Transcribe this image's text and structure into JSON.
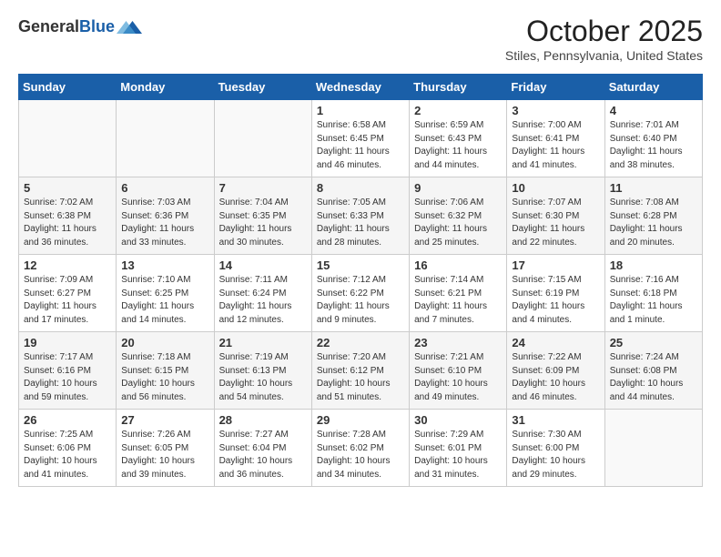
{
  "header": {
    "logo_general": "General",
    "logo_blue": "Blue",
    "month_title": "October 2025",
    "location": "Stiles, Pennsylvania, United States"
  },
  "days_of_week": [
    "Sunday",
    "Monday",
    "Tuesday",
    "Wednesday",
    "Thursday",
    "Friday",
    "Saturday"
  ],
  "weeks": [
    [
      {
        "day": "",
        "info": ""
      },
      {
        "day": "",
        "info": ""
      },
      {
        "day": "",
        "info": ""
      },
      {
        "day": "1",
        "info": "Sunrise: 6:58 AM\nSunset: 6:45 PM\nDaylight: 11 hours\nand 46 minutes."
      },
      {
        "day": "2",
        "info": "Sunrise: 6:59 AM\nSunset: 6:43 PM\nDaylight: 11 hours\nand 44 minutes."
      },
      {
        "day": "3",
        "info": "Sunrise: 7:00 AM\nSunset: 6:41 PM\nDaylight: 11 hours\nand 41 minutes."
      },
      {
        "day": "4",
        "info": "Sunrise: 7:01 AM\nSunset: 6:40 PM\nDaylight: 11 hours\nand 38 minutes."
      }
    ],
    [
      {
        "day": "5",
        "info": "Sunrise: 7:02 AM\nSunset: 6:38 PM\nDaylight: 11 hours\nand 36 minutes."
      },
      {
        "day": "6",
        "info": "Sunrise: 7:03 AM\nSunset: 6:36 PM\nDaylight: 11 hours\nand 33 minutes."
      },
      {
        "day": "7",
        "info": "Sunrise: 7:04 AM\nSunset: 6:35 PM\nDaylight: 11 hours\nand 30 minutes."
      },
      {
        "day": "8",
        "info": "Sunrise: 7:05 AM\nSunset: 6:33 PM\nDaylight: 11 hours\nand 28 minutes."
      },
      {
        "day": "9",
        "info": "Sunrise: 7:06 AM\nSunset: 6:32 PM\nDaylight: 11 hours\nand 25 minutes."
      },
      {
        "day": "10",
        "info": "Sunrise: 7:07 AM\nSunset: 6:30 PM\nDaylight: 11 hours\nand 22 minutes."
      },
      {
        "day": "11",
        "info": "Sunrise: 7:08 AM\nSunset: 6:28 PM\nDaylight: 11 hours\nand 20 minutes."
      }
    ],
    [
      {
        "day": "12",
        "info": "Sunrise: 7:09 AM\nSunset: 6:27 PM\nDaylight: 11 hours\nand 17 minutes."
      },
      {
        "day": "13",
        "info": "Sunrise: 7:10 AM\nSunset: 6:25 PM\nDaylight: 11 hours\nand 14 minutes."
      },
      {
        "day": "14",
        "info": "Sunrise: 7:11 AM\nSunset: 6:24 PM\nDaylight: 11 hours\nand 12 minutes."
      },
      {
        "day": "15",
        "info": "Sunrise: 7:12 AM\nSunset: 6:22 PM\nDaylight: 11 hours\nand 9 minutes."
      },
      {
        "day": "16",
        "info": "Sunrise: 7:14 AM\nSunset: 6:21 PM\nDaylight: 11 hours\nand 7 minutes."
      },
      {
        "day": "17",
        "info": "Sunrise: 7:15 AM\nSunset: 6:19 PM\nDaylight: 11 hours\nand 4 minutes."
      },
      {
        "day": "18",
        "info": "Sunrise: 7:16 AM\nSunset: 6:18 PM\nDaylight: 11 hours\nand 1 minute."
      }
    ],
    [
      {
        "day": "19",
        "info": "Sunrise: 7:17 AM\nSunset: 6:16 PM\nDaylight: 10 hours\nand 59 minutes."
      },
      {
        "day": "20",
        "info": "Sunrise: 7:18 AM\nSunset: 6:15 PM\nDaylight: 10 hours\nand 56 minutes."
      },
      {
        "day": "21",
        "info": "Sunrise: 7:19 AM\nSunset: 6:13 PM\nDaylight: 10 hours\nand 54 minutes."
      },
      {
        "day": "22",
        "info": "Sunrise: 7:20 AM\nSunset: 6:12 PM\nDaylight: 10 hours\nand 51 minutes."
      },
      {
        "day": "23",
        "info": "Sunrise: 7:21 AM\nSunset: 6:10 PM\nDaylight: 10 hours\nand 49 minutes."
      },
      {
        "day": "24",
        "info": "Sunrise: 7:22 AM\nSunset: 6:09 PM\nDaylight: 10 hours\nand 46 minutes."
      },
      {
        "day": "25",
        "info": "Sunrise: 7:24 AM\nSunset: 6:08 PM\nDaylight: 10 hours\nand 44 minutes."
      }
    ],
    [
      {
        "day": "26",
        "info": "Sunrise: 7:25 AM\nSunset: 6:06 PM\nDaylight: 10 hours\nand 41 minutes."
      },
      {
        "day": "27",
        "info": "Sunrise: 7:26 AM\nSunset: 6:05 PM\nDaylight: 10 hours\nand 39 minutes."
      },
      {
        "day": "28",
        "info": "Sunrise: 7:27 AM\nSunset: 6:04 PM\nDaylight: 10 hours\nand 36 minutes."
      },
      {
        "day": "29",
        "info": "Sunrise: 7:28 AM\nSunset: 6:02 PM\nDaylight: 10 hours\nand 34 minutes."
      },
      {
        "day": "30",
        "info": "Sunrise: 7:29 AM\nSunset: 6:01 PM\nDaylight: 10 hours\nand 31 minutes."
      },
      {
        "day": "31",
        "info": "Sunrise: 7:30 AM\nSunset: 6:00 PM\nDaylight: 10 hours\nand 29 minutes."
      },
      {
        "day": "",
        "info": ""
      }
    ]
  ]
}
